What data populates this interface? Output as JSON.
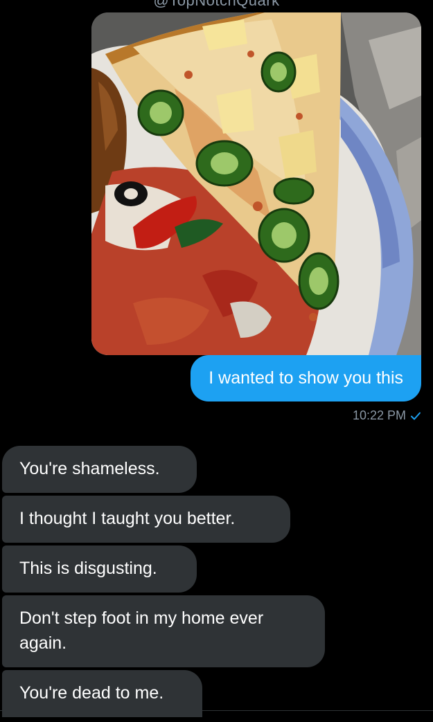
{
  "header": {
    "handle": "@TopNotchQuark"
  },
  "colors": {
    "background": "#000000",
    "sent_bubble": "#1da1f2",
    "received_bubble": "#2f3336",
    "meta_text": "#8b98a5"
  },
  "sent": {
    "photo_alt": "Photo of a pizza slice with jalapeños and pineapple",
    "text": "I wanted to show you this",
    "time": "10:22 PM",
    "status_icon": "check-icon"
  },
  "received": [
    {
      "text": "You're shameless."
    },
    {
      "text": "I thought I taught you better."
    },
    {
      "text": "This is disgusting."
    },
    {
      "text": "Don't step foot in my home ever again."
    },
    {
      "text": "You're dead to me."
    }
  ]
}
